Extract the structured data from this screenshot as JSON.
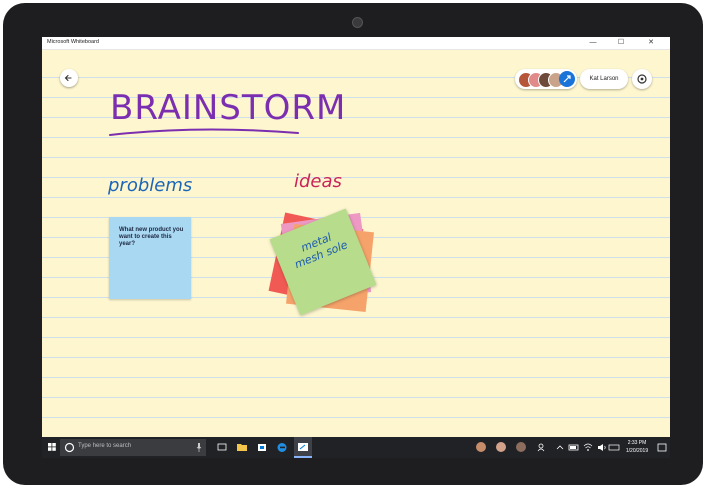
{
  "window": {
    "title": "Microsoft Whiteboard",
    "controls": {
      "minimize": "—",
      "maximize": "☐",
      "close": "✕"
    }
  },
  "header": {
    "back_icon": "back-arrow-icon",
    "collaborators": [
      "avatar-1",
      "avatar-2",
      "avatar-3"
    ],
    "share_icon": "share-icon",
    "user_name": "Kat Larson",
    "settings_icon": "gear-icon"
  },
  "board": {
    "heading": "BRAINSTORM",
    "label_problems": "problems",
    "label_ideas": "ideas",
    "blue_note": "What new product you want to create this year?",
    "green_note": "metal mesh sole",
    "colors": {
      "background": "#fdf6cf",
      "heading": "#7b2fb0",
      "problems": "#1c66b8",
      "ideas": "#c8245a"
    }
  },
  "toolbar": {
    "tools": [
      "pen-black",
      "pen-black",
      "pen-red",
      "pen-black",
      "pen-black",
      "pen-black",
      "highlighter-yellow",
      "eraser-icon",
      "ruler-icon",
      "lasso-icon",
      "add-icon",
      "undo-icon",
      "redo-icon"
    ]
  },
  "taskbar": {
    "search_placeholder": "Type here to search",
    "time": "2:33 PM",
    "date": "1/20/2019"
  }
}
